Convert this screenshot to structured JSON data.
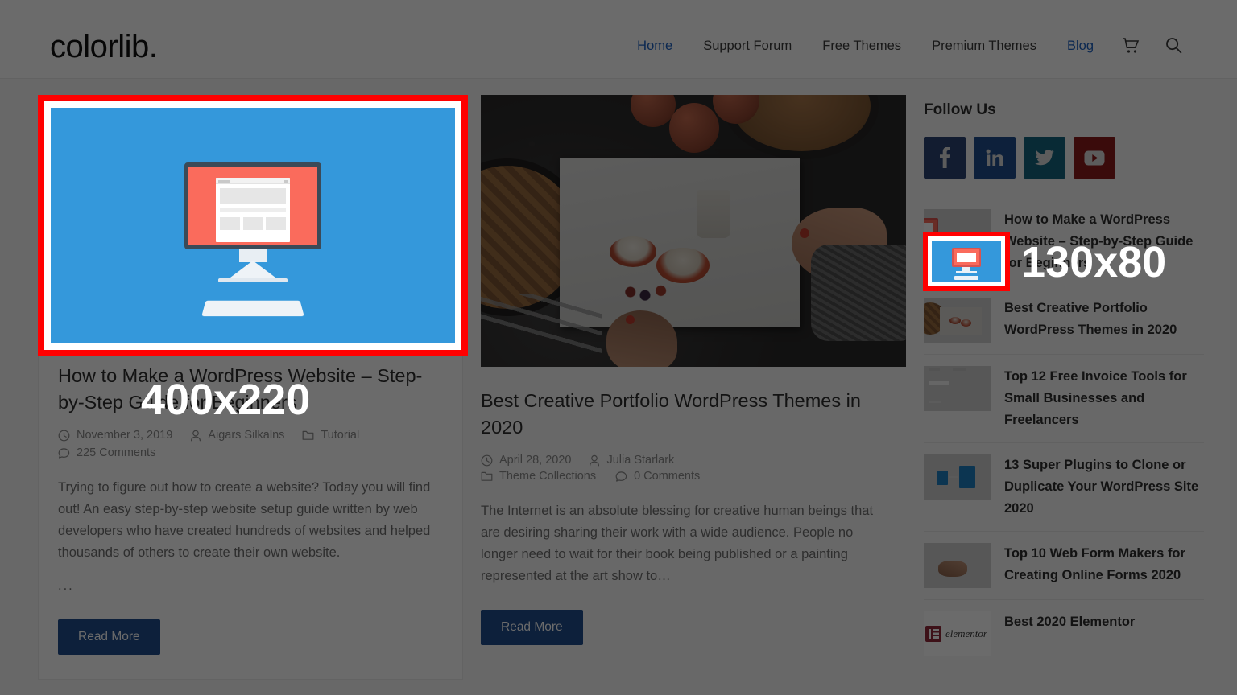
{
  "site": {
    "logo": "colorlib."
  },
  "nav": {
    "items": [
      {
        "label": "Home",
        "active": true
      },
      {
        "label": "Support Forum",
        "active": false
      },
      {
        "label": "Free Themes",
        "active": false
      },
      {
        "label": "Premium Themes",
        "active": false
      },
      {
        "label": "Blog",
        "active": true
      }
    ],
    "cart_icon": "cart-icon",
    "search_icon": "search-icon"
  },
  "posts": [
    {
      "title": "How to Make a WordPress Website – Step-by-Step Guide for Beginners",
      "date": "November 3, 2019",
      "author": "Aigars Silkalns",
      "category": "Tutorial",
      "comments": "225 Comments",
      "excerpt": "Trying to figure out how to create a website? Today you will find out! An easy step-by-step website setup guide written by web developers who have created hundreds of websites and helped thousands of others to create their own website.",
      "ellipsis": "...",
      "read_more": "Read More",
      "image_alt": "wordpress-website-illustration"
    },
    {
      "title": "Best Creative Portfolio WordPress Themes in 2020",
      "date": "April 28, 2020",
      "author": "Julia Starlark",
      "category": "Theme Collections",
      "comments": "0 Comments",
      "excerpt": "The Internet is an absolute blessing for creative human beings that are desiring sharing their work with a wide audience. People no longer need to wait for their book being published or a painting represented at the art show to…",
      "read_more": "Read More",
      "image_alt": "creative-portfolio-food-photography"
    }
  ],
  "sidebar": {
    "follow_title": "Follow Us",
    "socials": [
      {
        "name": "facebook",
        "color": "#2d4373"
      },
      {
        "name": "linkedin",
        "color": "#1f4e8c"
      },
      {
        "name": "twitter",
        "color": "#15657f"
      },
      {
        "name": "youtube",
        "color": "#8b1b1b"
      }
    ],
    "posts": [
      {
        "title": "How to Make a WordPress Website – Step-by-Step Guide for Beginners",
        "thumb": "wordpress-monitor-thumb"
      },
      {
        "title": "Best Creative Portfolio WordPress Themes in 2020",
        "thumb": "food-photo-thumb"
      },
      {
        "title": "Top 12 Free Invoice Tools for Small Businesses and Freelancers",
        "thumb": "invoice-tool-thumb"
      },
      {
        "title": "13 Super Plugins to Clone or Duplicate Your WordPress Site 2020",
        "thumb": "clone-plugins-thumb"
      },
      {
        "title": "Top 10 Web Form Makers for Creating Online Forms 2020",
        "thumb": "web-forms-thumb"
      },
      {
        "title": "Best 2020 Elementor",
        "thumb": "elementor-logo-thumb"
      }
    ]
  },
  "annotations": {
    "highlight_color": "#ff0000",
    "main_image_label": "400x220",
    "sidebar_thumb_label": "130x80"
  }
}
